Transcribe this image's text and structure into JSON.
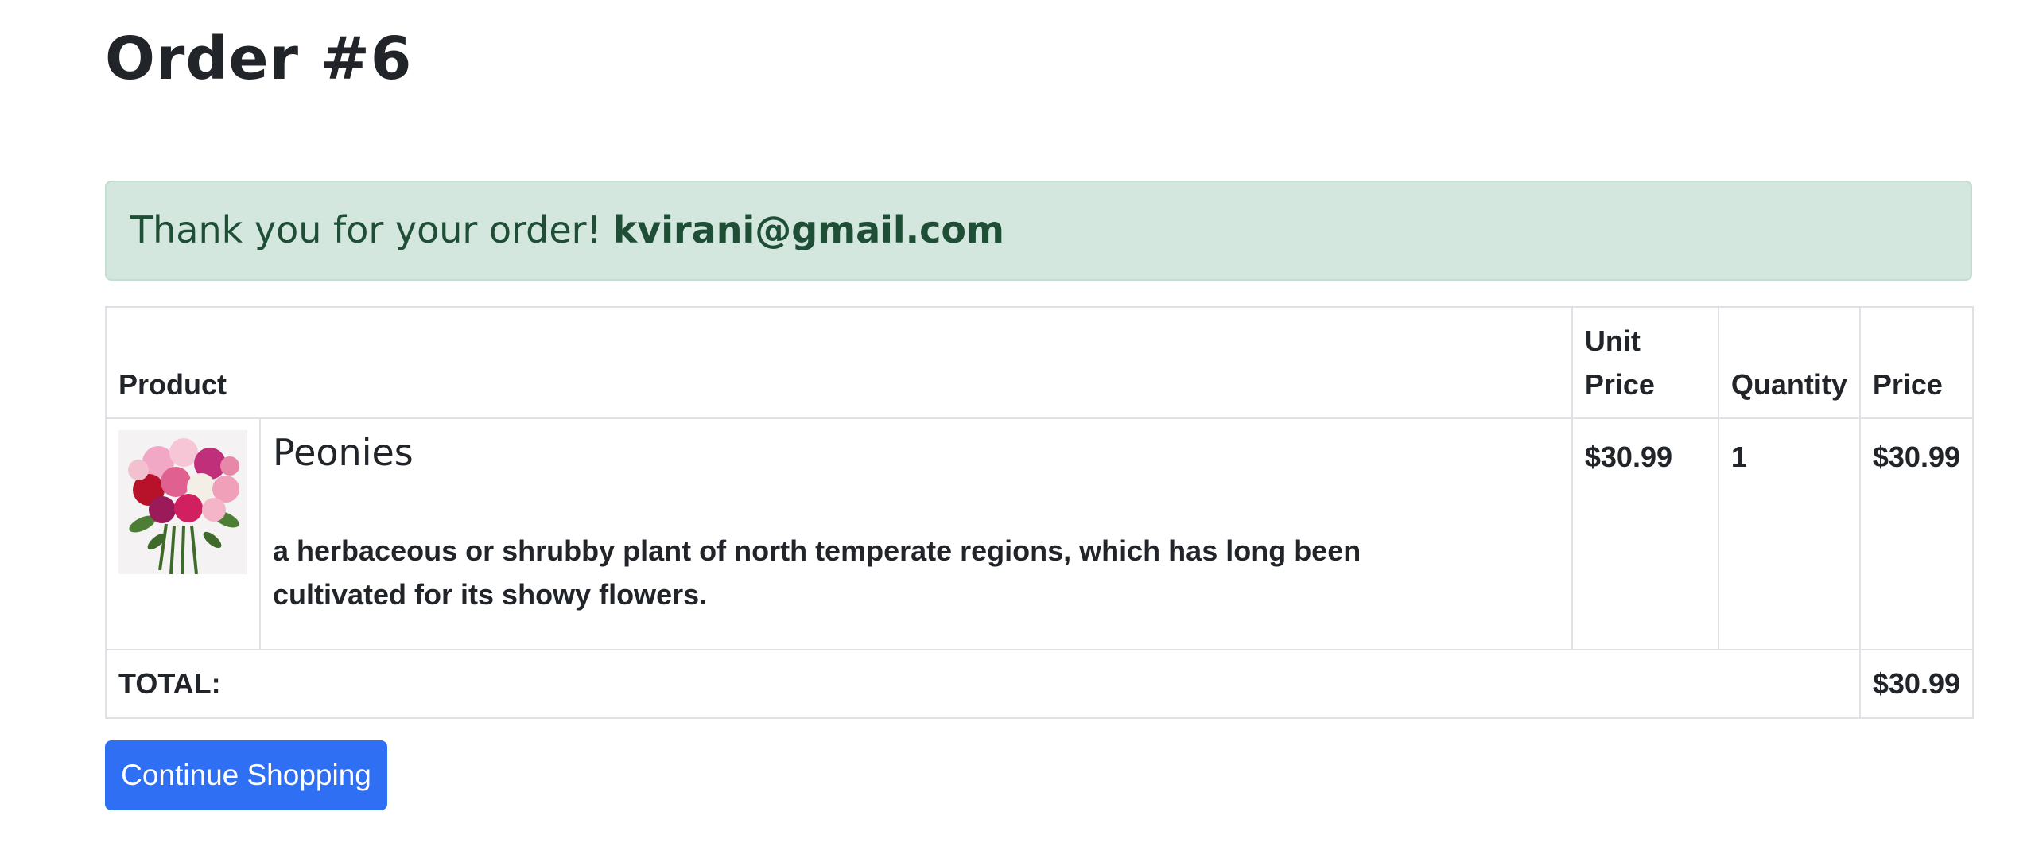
{
  "page": {
    "title": "Order #6"
  },
  "alert": {
    "message": "Thank you for your order!",
    "email": "kvirani@gmail.com"
  },
  "table": {
    "headers": {
      "product": "Product",
      "unit_price": "Unit\nPrice",
      "quantity": "Quantity",
      "price": "Price"
    },
    "items": [
      {
        "name": "Peonies",
        "description": "a herbaceous or shrubby plant of north temperate regions, which has long been cultivated for its showy flowers.",
        "unit_price": "$30.99",
        "quantity": "1",
        "price": "$30.99",
        "image_icon": "peony-bouquet-image"
      }
    ],
    "total_label": "TOTAL:",
    "total_value": "$30.99"
  },
  "actions": {
    "continue_label": "Continue Shopping"
  },
  "colors": {
    "alert_bg": "#d4e7de",
    "alert_text": "#1f4e37",
    "button_bg": "#2f6ff3"
  }
}
